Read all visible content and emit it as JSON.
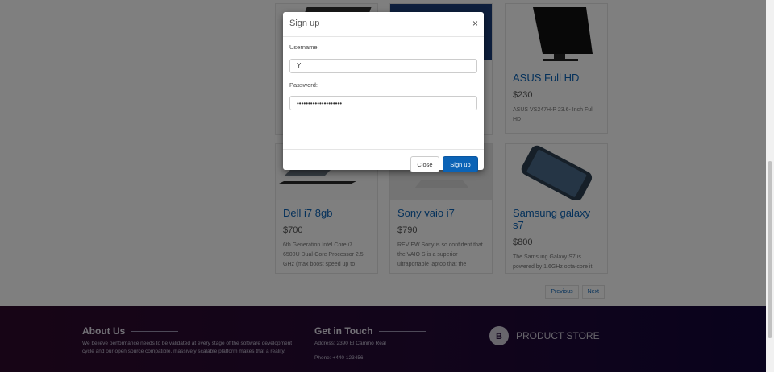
{
  "products": [
    {
      "title": "Dell i7 8gb",
      "price": "$700",
      "desc": "6th Generation Intel Core i7 6500U Dual-Core Processor 2.5 GHz (max boost speed up to"
    },
    {
      "title": "Sony vaio i7",
      "price": "$790",
      "desc": "REVIEW Sony is so confident that the VAIO S is a superior ultraportable laptop that the"
    },
    {
      "title": "Samsung galaxy s7",
      "price": "$800",
      "desc": "The Samsung Galaxy S7 is powered by 1.6GHz octa-core it comes with 4GB of RAM. The"
    },
    {
      "title": "ASUS Full HD",
      "price": "$230",
      "desc": "ASUS VS247H-P 23.6- Inch Full HD"
    }
  ],
  "pagination": {
    "previous": "Previous",
    "next": "Next"
  },
  "footer": {
    "about_title": "About Us",
    "about_text": "We believe performance needs to be validated at every stage of the software development cycle and our open source compatible, massively scalable platform makes that a reality.",
    "touch_title": "Get in Touch",
    "address": "Address: 2390 El Camino Real",
    "phone": "Phone: +440 123456",
    "brand": "PRODUCT STORE"
  },
  "modal": {
    "title": "Sign up",
    "close_symbol": "×",
    "username_label": "Username:",
    "username_value": "Y",
    "password_label": "Password:",
    "password_value": "••••••••••••••••••••",
    "close_label": "Close",
    "submit_label": "Sign up"
  },
  "colors": {
    "accent": "#0b63b6",
    "footer_start": "#2f0b2c",
    "footer_end": "#13063a"
  }
}
